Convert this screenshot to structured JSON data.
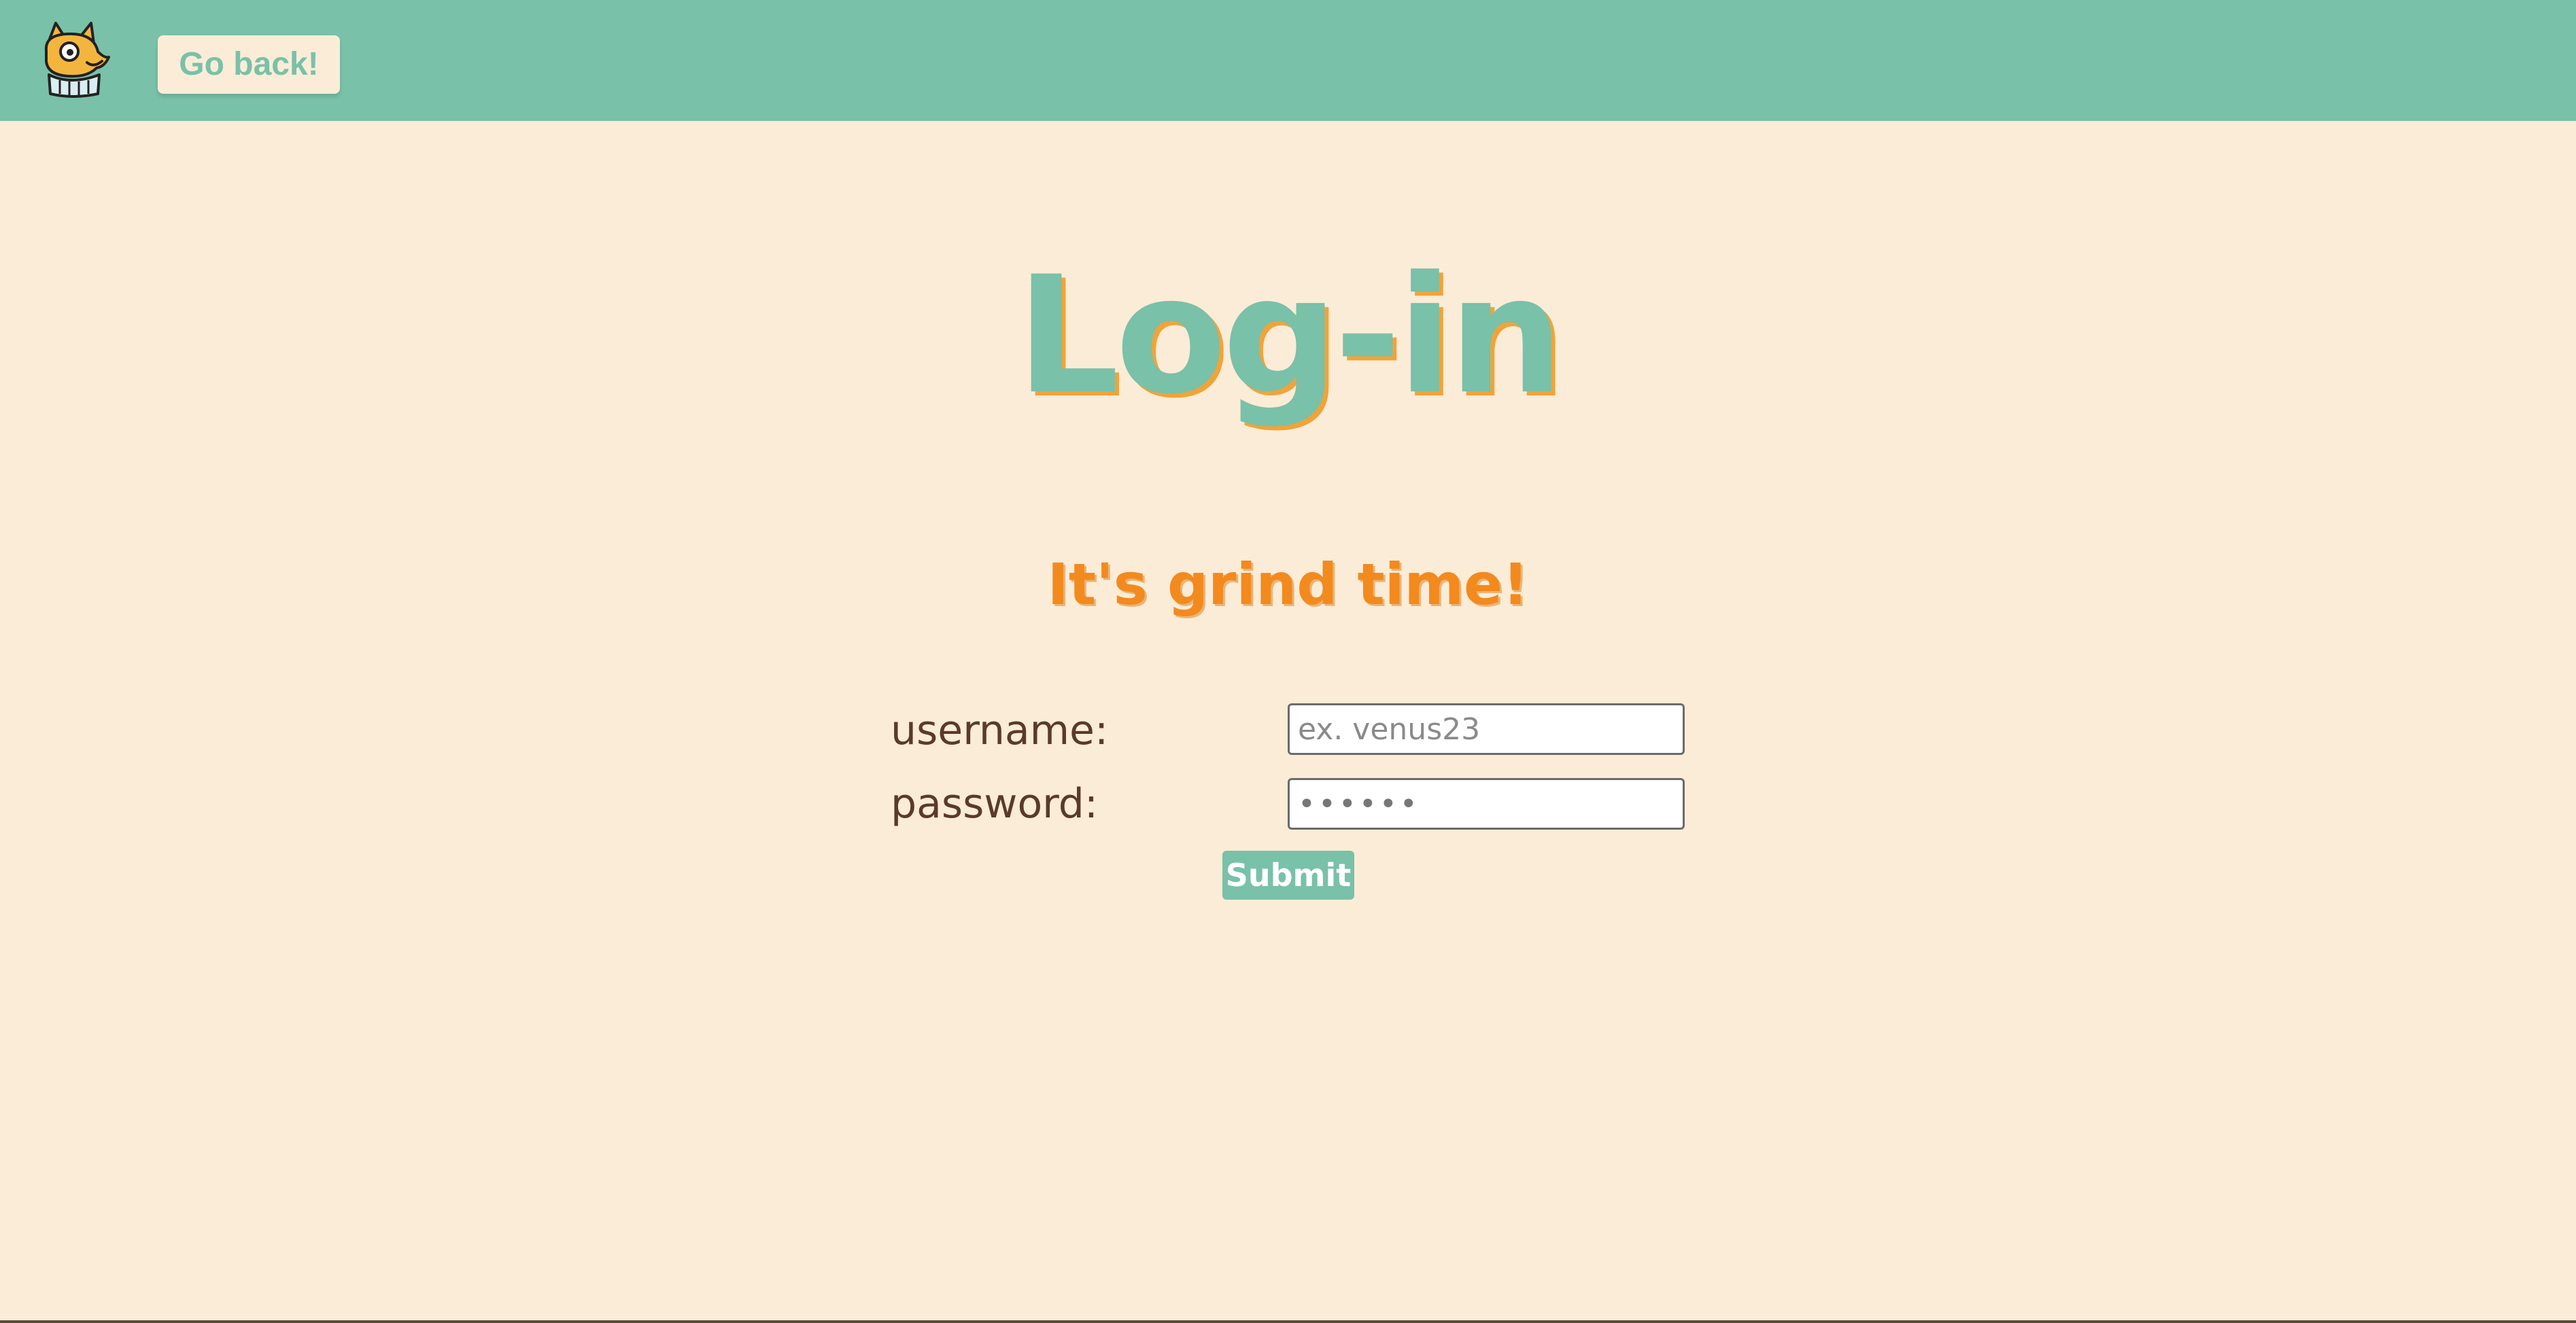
{
  "header": {
    "logo_icon": "cat-mascot-logo-icon",
    "back_button_label": "Go back!"
  },
  "main": {
    "title": "Log-in",
    "subtitle": "It's grind time!"
  },
  "form": {
    "username_label": "username:",
    "username_placeholder": "ex. venus23",
    "username_value": "",
    "password_label": "password:",
    "password_value": "••••••",
    "submit_label": "Submit"
  },
  "colors": {
    "header_bg": "#79c1a8",
    "page_bg": "#fbecd7",
    "title_color": "#79c1a8",
    "title_shadow": "#f1a33a",
    "subtitle_color": "#f28a1e",
    "label_color": "#5a3a2a",
    "button_bg": "#79c1a8"
  }
}
